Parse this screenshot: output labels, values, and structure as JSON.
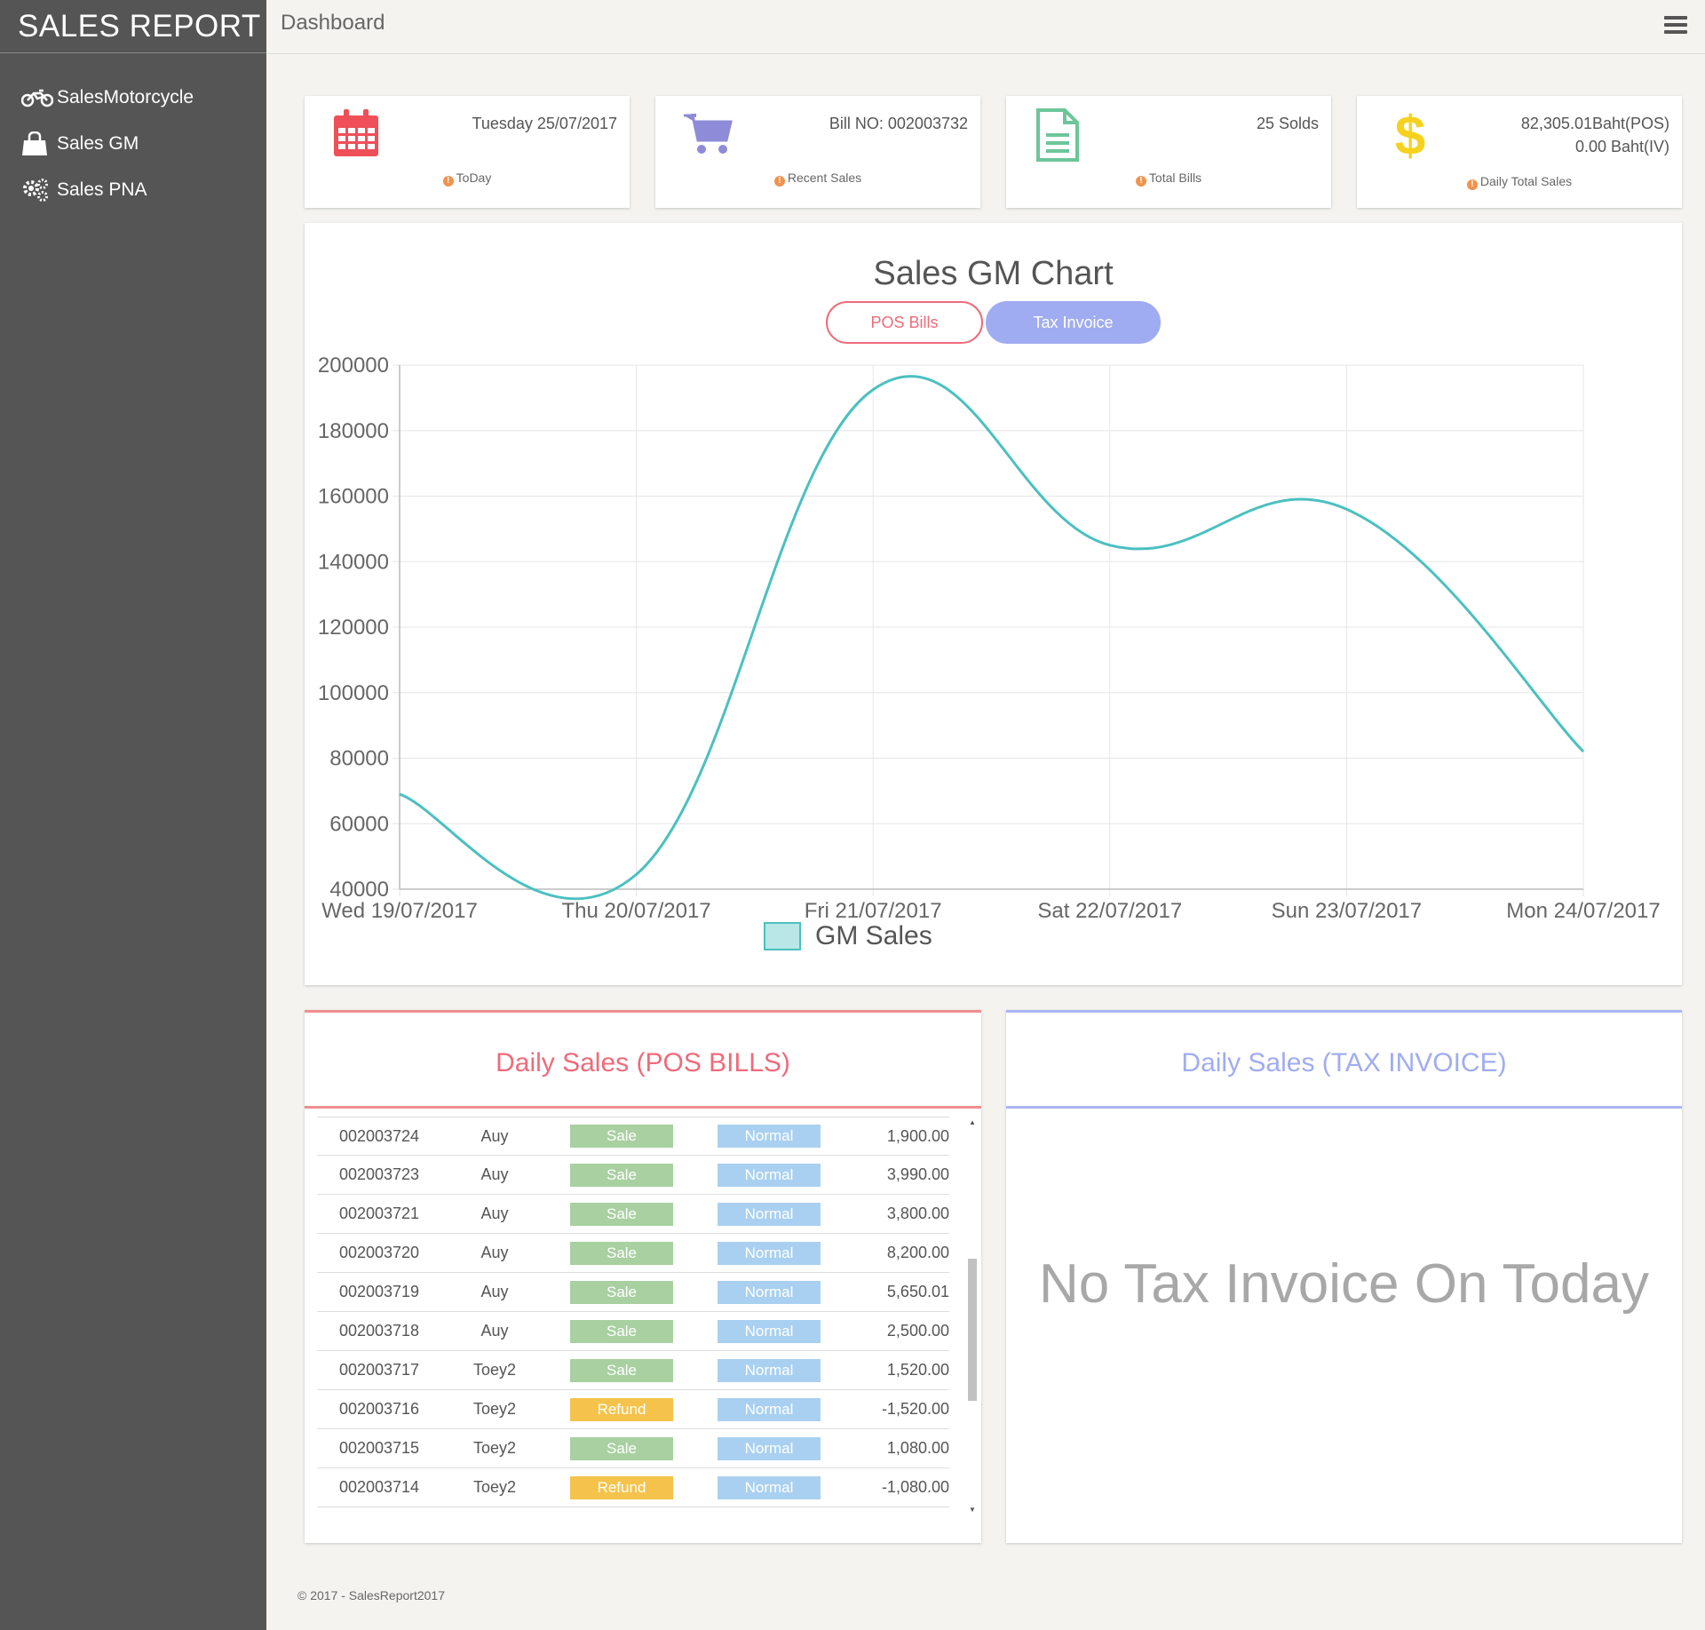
{
  "sidebar": {
    "brand": "SALES REPORT",
    "items": [
      {
        "label": "SalesMotorcycle",
        "icon": "motorcycle-icon"
      },
      {
        "label": "Sales GM",
        "icon": "shopping-bag-icon"
      },
      {
        "label": "Sales PNA",
        "icon": "gears-icon"
      }
    ]
  },
  "topbar": {
    "title": "Dashboard",
    "menu_icon": "hamburger-icon"
  },
  "stats": [
    {
      "icon": "calendar-icon",
      "value": "Tuesday 25/07/2017",
      "footer": "ToDay",
      "color": "#ef4f58"
    },
    {
      "icon": "shopping-cart-icon",
      "value": "Bill NO: 002003732",
      "footer": "Recent Sales",
      "color": "#8e8cd8"
    },
    {
      "icon": "document-icon",
      "value": "25 Solds",
      "footer": "Total Bills",
      "color": "#6cc69a"
    },
    {
      "icon": "dollar-icon",
      "value": "82,305.01Baht(POS)",
      "value2": "0.00 Baht(IV)",
      "footer": "Daily Total Sales",
      "color": "#f6d21f"
    }
  ],
  "chart_section": {
    "title": "Sales GM Chart",
    "btn_pos": "POS Bills",
    "btn_tax": "Tax Invoice"
  },
  "chart_data": {
    "type": "line",
    "title": "Sales GM Chart",
    "categories": [
      "Wed 19/07/2017",
      "Thu 20/07/2017",
      "Fri 21/07/2017",
      "Sat 22/07/2017",
      "Sun 23/07/2017",
      "Mon 24/07/2017"
    ],
    "series": [
      {
        "name": "GM Sales",
        "values": [
          69000,
          44500,
          192500,
          145000,
          156000,
          82000
        ],
        "color": "#4bc0c0"
      }
    ],
    "ylim": [
      40000,
      200000
    ],
    "yticks": [
      40000,
      60000,
      80000,
      100000,
      120000,
      140000,
      160000,
      180000,
      200000
    ],
    "grid": true,
    "legend": "bottom"
  },
  "daily_pos": {
    "title": "Daily Sales (POS BILLS)",
    "rows": [
      {
        "bill": "002003724",
        "user": "Auy",
        "type": "Sale",
        "status": "Normal",
        "amount": "1,900.00"
      },
      {
        "bill": "002003723",
        "user": "Auy",
        "type": "Sale",
        "status": "Normal",
        "amount": "3,990.00"
      },
      {
        "bill": "002003721",
        "user": "Auy",
        "type": "Sale",
        "status": "Normal",
        "amount": "3,800.00"
      },
      {
        "bill": "002003720",
        "user": "Auy",
        "type": "Sale",
        "status": "Normal",
        "amount": "8,200.00"
      },
      {
        "bill": "002003719",
        "user": "Auy",
        "type": "Sale",
        "status": "Normal",
        "amount": "5,650.01"
      },
      {
        "bill": "002003718",
        "user": "Auy",
        "type": "Sale",
        "status": "Normal",
        "amount": "2,500.00"
      },
      {
        "bill": "002003717",
        "user": "Toey2",
        "type": "Sale",
        "status": "Normal",
        "amount": "1,520.00"
      },
      {
        "bill": "002003716",
        "user": "Toey2",
        "type": "Refund",
        "status": "Normal",
        "amount": "-1,520.00"
      },
      {
        "bill": "002003715",
        "user": "Toey2",
        "type": "Sale",
        "status": "Normal",
        "amount": "1,080.00"
      },
      {
        "bill": "002003714",
        "user": "Toey2",
        "type": "Refund",
        "status": "Normal",
        "amount": "-1,080.00"
      }
    ]
  },
  "daily_tax": {
    "title": "Daily Sales (TAX INVOICE)",
    "empty_message": "No Tax Invoice On Today"
  },
  "footer": "© 2017 - SalesReport2017"
}
